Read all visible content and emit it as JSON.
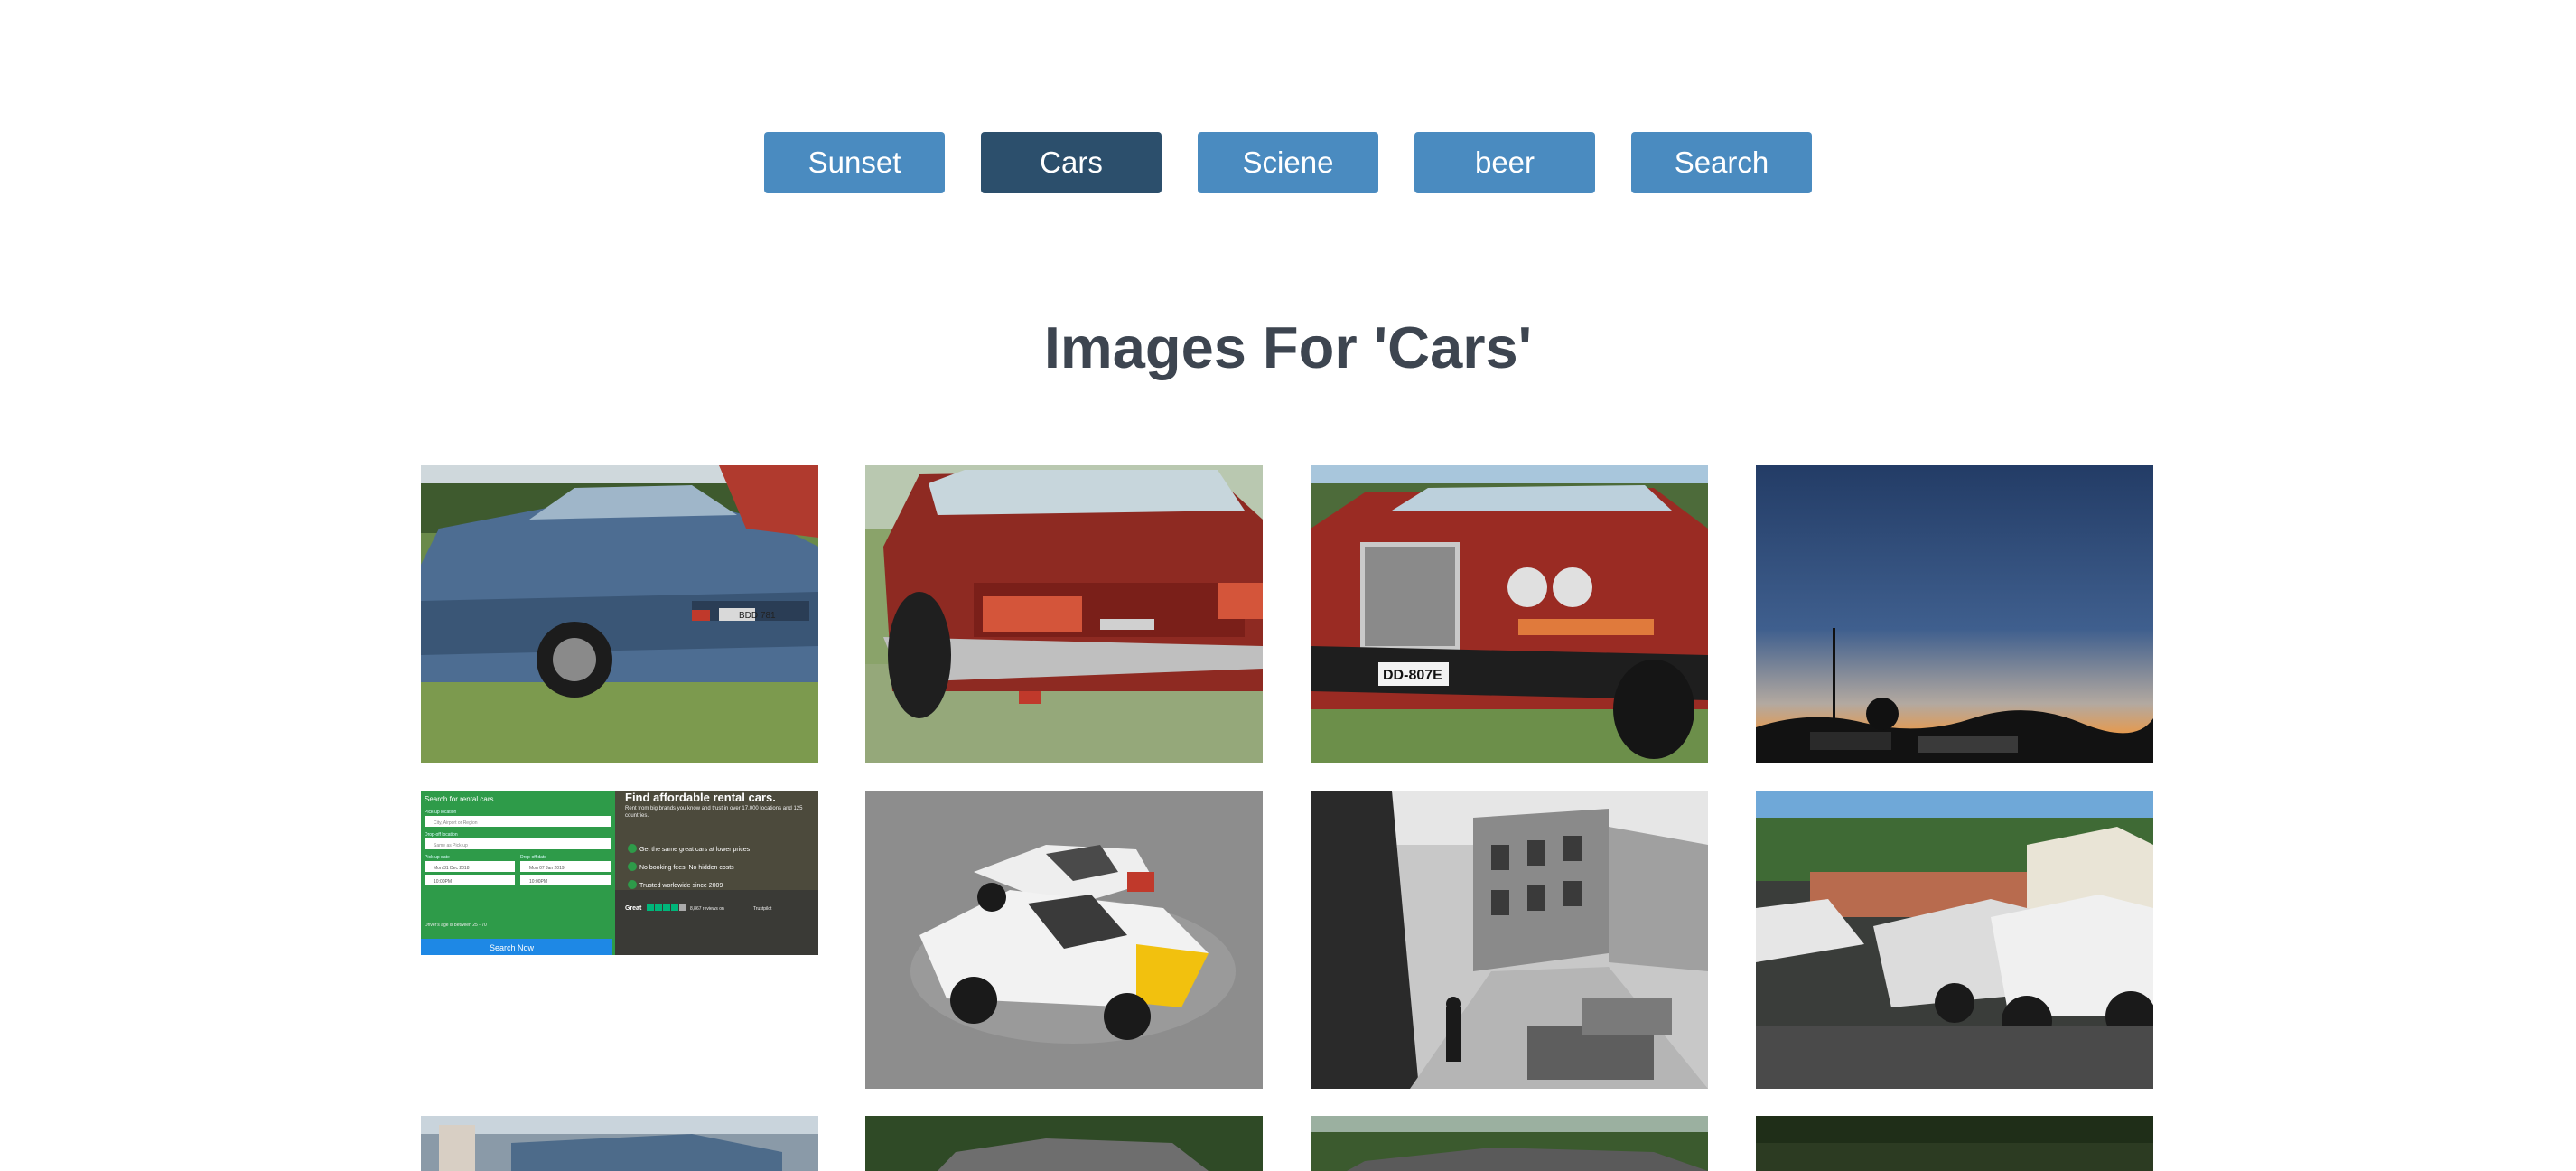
{
  "categories": [
    {
      "label": "Sunset",
      "active": false
    },
    {
      "label": "Cars",
      "active": true
    },
    {
      "label": "Sciene",
      "active": false
    },
    {
      "label": "beer",
      "active": false
    },
    {
      "label": "Search",
      "active": false
    }
  ],
  "heading": "Images For 'Cars'",
  "rental_ad": {
    "title": "Find affordable rental cars.",
    "subtitle": "Rent from big brands you know and trust in over 17,000 locations and 125 countries.",
    "form_title": "Search for rental cars",
    "pickup_label": "Pick-up location",
    "pickup_placeholder": "City, Airport or Region",
    "dropoff_label": "Drop-off location",
    "dropoff_placeholder": "Same as Pick-up",
    "pickup_date_label": "Pick-up date",
    "pickup_date": "Mon 31 Dec 2018",
    "dropoff_date_label": "Drop-off date",
    "dropoff_date": "Mon 07 Jan 2019",
    "pickup_time": "10:00PM",
    "dropoff_time": "10:00PM",
    "driver_age": "Driver's age is between 25 - 70",
    "feature_1": "Get the same great cars at lower prices",
    "feature_2": "No booking fees. No hidden costs",
    "feature_3": "Trusted worldwide since 2009",
    "rating_word": "Great",
    "rating_reviews": "8,867 reviews on",
    "rating_brand": "Trustpilot",
    "search_button": "Search Now"
  },
  "plates": {
    "plate_1": "BDD 781",
    "plate_3": "DD-807E"
  },
  "colors": {
    "button": "#4a8bc0",
    "button_active": "#2c4f6c",
    "heading": "#3d4550",
    "ad_green": "#2e9b49",
    "ad_blue": "#1e88e5"
  }
}
